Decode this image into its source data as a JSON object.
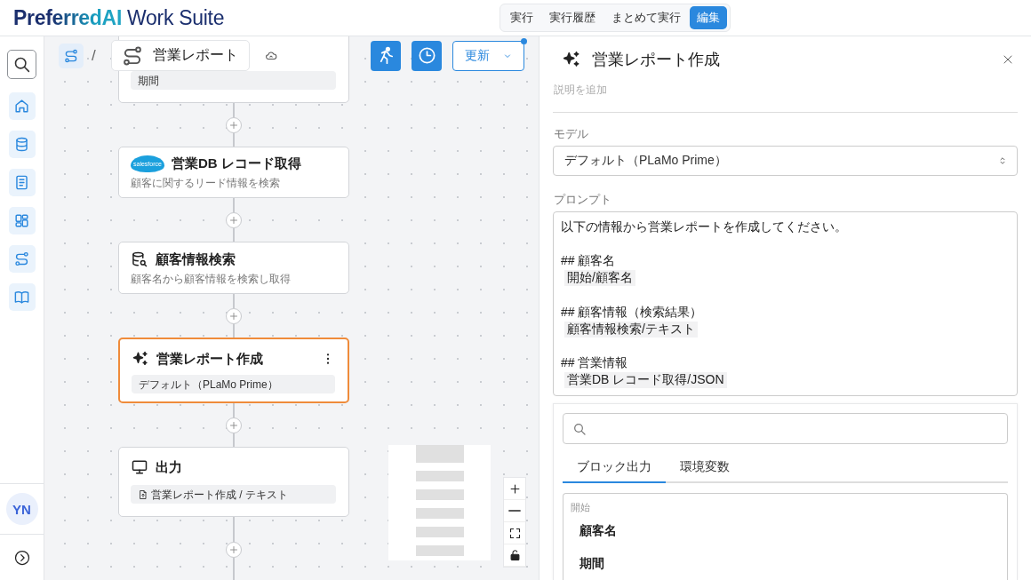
{
  "header": {
    "logo": "**PreferredAI** Work Suite",
    "modes": [
      {
        "label": "実行",
        "selected": false
      },
      {
        "label": "実行履歴",
        "selected": false
      },
      {
        "label": "まとめて実行",
        "selected": false
      },
      {
        "label": "編集",
        "selected": true
      }
    ]
  },
  "sidebar": {
    "items": [
      {
        "kind": "search"
      },
      {
        "kind": "home"
      },
      {
        "kind": "database"
      },
      {
        "kind": "document"
      },
      {
        "kind": "dashboard"
      },
      {
        "kind": "flow"
      },
      {
        "kind": "book"
      }
    ],
    "avatar": "YN"
  },
  "toolbar": {
    "separator": "/",
    "breadcrumb": "営業レポート",
    "update_button": "更新",
    "update_badge": true
  },
  "canvas": {
    "nodes": [
      {
        "kind": "partial",
        "chip": "期間",
        "selected": false
      },
      {
        "kind": "salesforce",
        "logo_text": "salesforce",
        "title": "営業DB レコード取得",
        "description": "顧客に関するリード情報を検索",
        "selected": false
      },
      {
        "kind": "search",
        "title": "顧客情報検索",
        "description": "顧客名から顧客情報を検索し取得",
        "selected": false
      },
      {
        "kind": "llm",
        "title": "営業レポート作成",
        "chip": "デフォルト（PLaMo Prime）",
        "selected": true
      },
      {
        "kind": "output",
        "title": "出力",
        "chip": "営業レポート作成 / テキスト",
        "selected": false
      }
    ]
  },
  "panel": {
    "title": "営業レポート作成",
    "description_placeholder": "説明を追加",
    "model_label": "モデル",
    "model": "デフォルト（PLaMo Prime）",
    "prompt_label": "プロンプト",
    "prompt": [
      {
        "kind": "text",
        "text": "以下の情報から営業レポートを作成してください。"
      },
      {
        "kind": "blank"
      },
      {
        "kind": "text",
        "text": "## 顧客名"
      },
      {
        "kind": "ref",
        "text": "開始/顧客名"
      },
      {
        "kind": "blank"
      },
      {
        "kind": "text",
        "text": "## 顧客情報（検索結果）"
      },
      {
        "kind": "ref",
        "text": "顧客情報検索/テキスト"
      },
      {
        "kind": "blank"
      },
      {
        "kind": "text",
        "text": "## 営業情報"
      },
      {
        "kind": "ref",
        "text": "営業DB レコード取得/JSON"
      }
    ],
    "picker": {
      "tabs": [
        {
          "label": "ブロック出力",
          "selected": true
        },
        {
          "label": "環境変数",
          "selected": false
        }
      ],
      "groups": [
        {
          "label": "開始",
          "items": [
            "顧客名",
            "期間"
          ]
        }
      ]
    }
  }
}
